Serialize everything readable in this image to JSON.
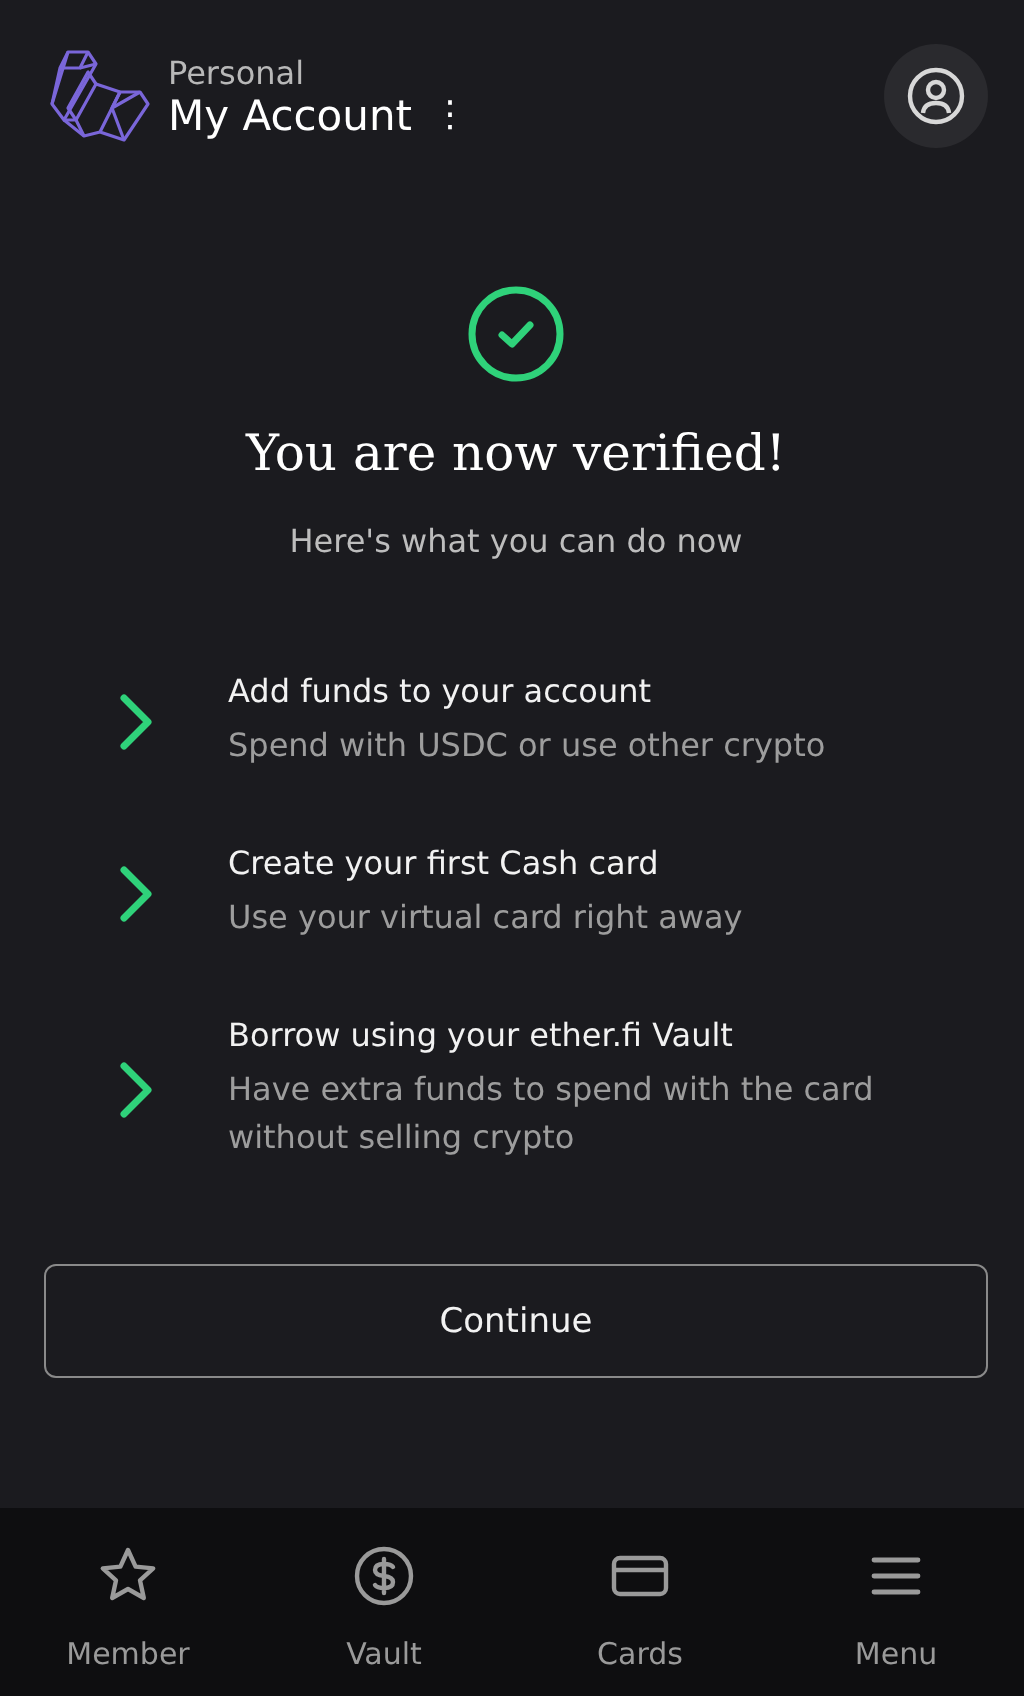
{
  "header": {
    "account_type": "Personal",
    "account_name": "My Account",
    "more": "⋮"
  },
  "hero": {
    "title": "You are now verified!",
    "subtitle": "Here's what you can do now"
  },
  "steps": [
    {
      "title": "Add funds to your account",
      "description": "Spend with USDC or use other crypto"
    },
    {
      "title": "Create your first Cash card",
      "description": "Use your virtual card right away"
    },
    {
      "title": "Borrow using your ether.fi Vault",
      "description": "Have extra funds to spend with the card without selling crypto"
    }
  ],
  "continue_button": "Continue",
  "bottom_nav": [
    {
      "label": "Member",
      "kind": "star"
    },
    {
      "label": "Vault",
      "kind": "dollar"
    },
    {
      "label": "Cards",
      "kind": "card"
    },
    {
      "label": "Menu",
      "kind": "menu"
    }
  ]
}
